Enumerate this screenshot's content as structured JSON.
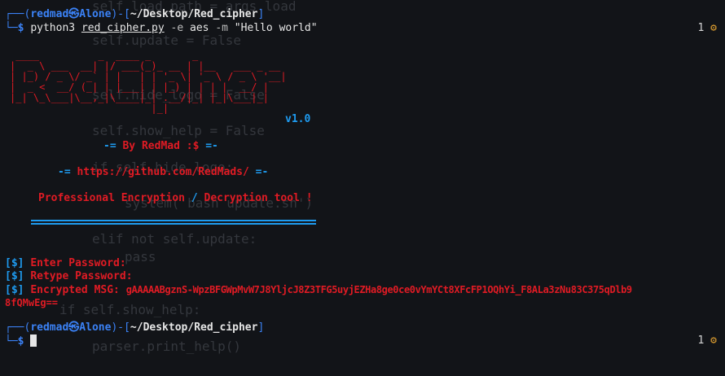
{
  "prompt1": {
    "user": "redmad",
    "host": "Alone",
    "path": "~/Desktop/Red_cipher",
    "cmd_program": "python3",
    "cmd_script": "red_cipher.py",
    "cmd_flag1": "-e",
    "cmd_arg1": "aes",
    "cmd_flag2": "-m",
    "cmd_arg2": "\"Hello world\"",
    "job_count": "1"
  },
  "banner": {
    "ascii_art": " ____          _  ____ _       _               \n|  _ \\ ___  __| |/ ___(_)_ __ | |__   ___ _ __ \n| |_) / _ \\/ _` | |   | | '_ \\| '_ \\ / _ \\ '__|\n|  _ <  __/ (_| | |___| | |_) | | | |  __/ |   \n|_| \\_\\___|\\__,_|\\____|_| .__/|_| |_|\\___|_|   \n                        |_|                     ",
    "version": "v1.0",
    "by_prefix": "-= ",
    "by_text": "By RedMad :$",
    "by_suffix": " =-",
    "url_prefix": "-= ",
    "url": "https://github.com/RedMads/",
    "url_suffix": " =-",
    "tagline_part1": "Professional Encryption",
    "tagline_slash": " / ",
    "tagline_part2": "Decryption tool !"
  },
  "output": {
    "enter_password_tag": "[$]",
    "enter_password": "Enter Password:",
    "retype_password_tag": "[$]",
    "retype_password": "Retype Password:",
    "encrypted_tag": "[$]",
    "encrypted_label": "Encrypted MSG:",
    "encrypted_value_line1": "gAAAAABgznS-WpzBFGWpMvW7J8YljcJ8Z3TFG5uyjEZHa8ge0ce0vYmYCt8XFcFP1OQhYi_F8ALa3zNu83C375qDlb9",
    "encrypted_value_line2": "8fQMwEg=="
  },
  "prompt2": {
    "user": "redmad",
    "host": "Alone",
    "path": "~/Desktop/Red_cipher",
    "job_count": "1"
  },
  "background_code": [
    "self.load_path = args.load",
    "self.update = False",
    "self.hide_logo = False",
    "self.show_help = False",
    "if self.hide_logo:",
    "system('bash update.sh')",
    "elif not self.update:",
    "pass",
    "if self.show_help:",
    "parser.print_help()"
  ],
  "icons": {
    "prompt_separator": "skull-icon",
    "status": "gear-icon"
  },
  "colors": {
    "background": "#121418",
    "accent_blue": "#3b82f6",
    "banner_red": "#e01b24",
    "version_cyan": "#1e9bf0"
  }
}
